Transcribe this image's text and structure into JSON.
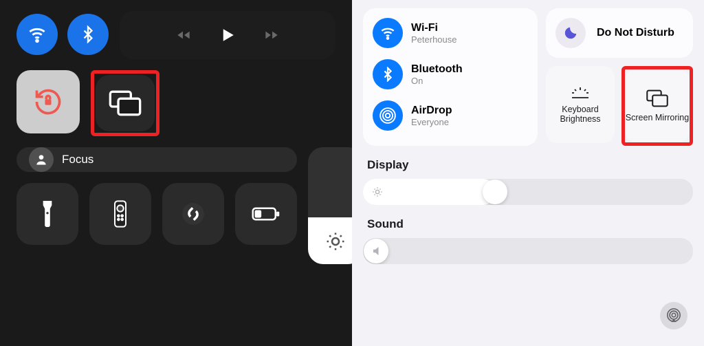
{
  "left": {
    "focus_label": "Focus",
    "brightness_level": 0.4,
    "volume_level": 0
  },
  "right": {
    "wifi": {
      "title": "Wi-Fi",
      "subtitle": "Peterhouse"
    },
    "bluetooth": {
      "title": "Bluetooth",
      "subtitle": "On"
    },
    "airdrop": {
      "title": "AirDrop",
      "subtitle": "Everyone"
    },
    "dnd": {
      "title": "Do Not Disturb"
    },
    "kb_brightness": {
      "label": "Keyboard Brightness"
    },
    "screen_mirroring": {
      "label": "Screen Mirroring"
    },
    "display": {
      "label": "Display",
      "level": 0.38
    },
    "sound": {
      "label": "Sound",
      "level": 0
    }
  }
}
